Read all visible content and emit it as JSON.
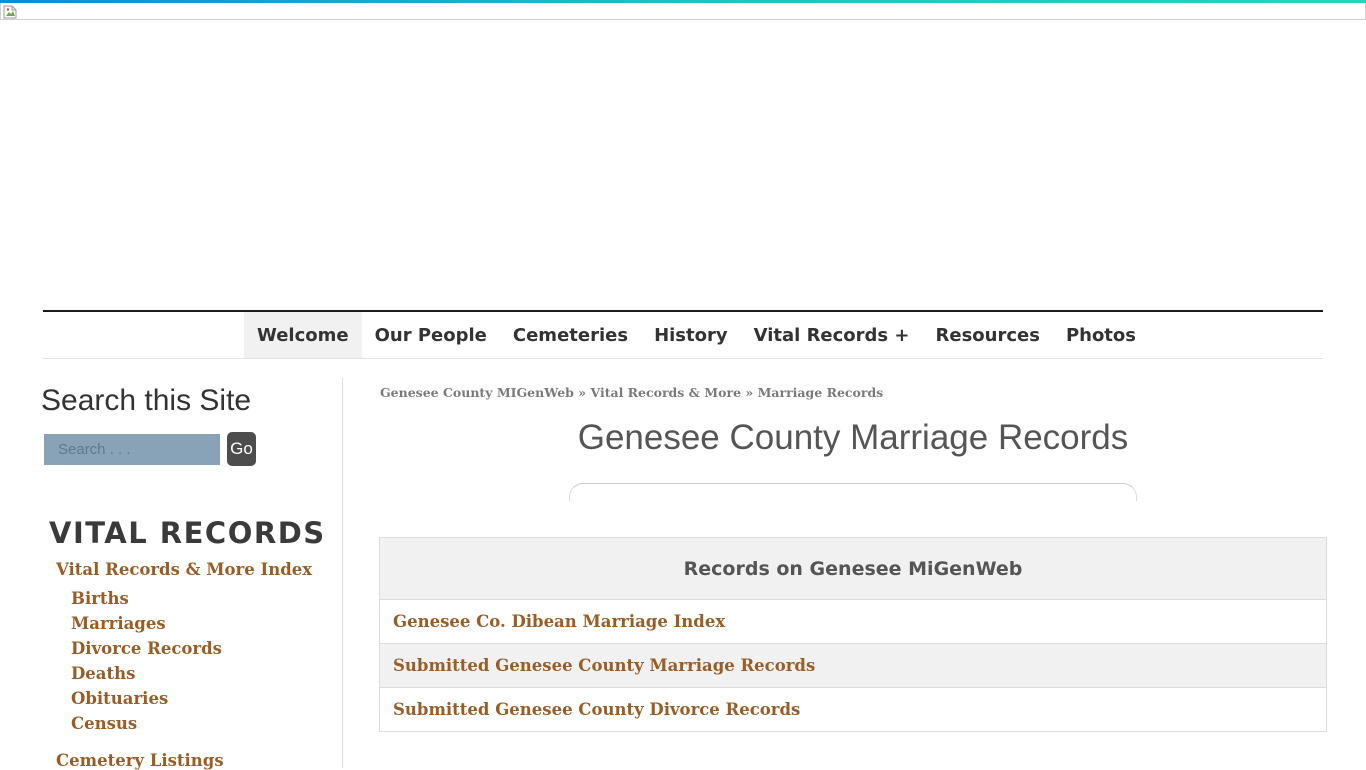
{
  "nav": {
    "items": [
      "Welcome",
      "Our People",
      "Cemeteries",
      "History",
      "Vital Records +",
      "Resources",
      "Photos"
    ],
    "active": "Welcome"
  },
  "search": {
    "title": "Search this Site",
    "placeholder": "Search . . .",
    "button_label": "Go"
  },
  "sidebar": {
    "heading": "VITAL RECORDS",
    "index_link": "Vital Records & More Index",
    "sub_links": [
      "Births",
      "Marriages",
      "Divorce Records",
      "Deaths",
      "Obituaries",
      "Census"
    ],
    "cemetery_link": "Cemetery Listings"
  },
  "breadcrumb": {
    "items": [
      "Genesee County MIGenWeb",
      "Vital Records & More",
      "Marriage Records"
    ],
    "separator": "»"
  },
  "main": {
    "title": "Genesee County Marriage Records",
    "table_header": "Records on Genesee MiGenWeb",
    "rows": [
      "Genesee Co. Dibean Marriage Index",
      "Submitted Genesee County Marriage Records",
      "Submitted Genesee County Divorce Records"
    ]
  },
  "colors": {
    "link": "#9a5d25",
    "header_bg": "#f1f1f1",
    "search_bg": "#88a3b8",
    "go_button_bg": "#4d4d4d"
  }
}
